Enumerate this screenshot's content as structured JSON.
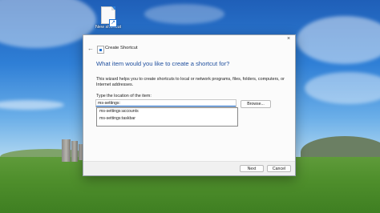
{
  "desktop": {
    "icon_label": "New shortcut"
  },
  "dialog": {
    "title": "Create Shortcut",
    "heading": "What item would you like to create a shortcut for?",
    "description": "This wizard helps you to create shortcuts to local or network programs, files, folders, computers, or Internet addresses.",
    "location_label": "Type the location of the item:",
    "location_value": "ms-settings:",
    "browse_label": "Browse...",
    "suggestions": [
      "ms-settings:accounts",
      "ms-settings:taskbar"
    ],
    "next_label": "Next",
    "cancel_label": "Cancel",
    "close_glyph": "×",
    "back_glyph": "←"
  },
  "icons": [
    "shortcut-file-icon",
    "back-arrow-icon",
    "shortcut-app-icon",
    "close-icon"
  ]
}
